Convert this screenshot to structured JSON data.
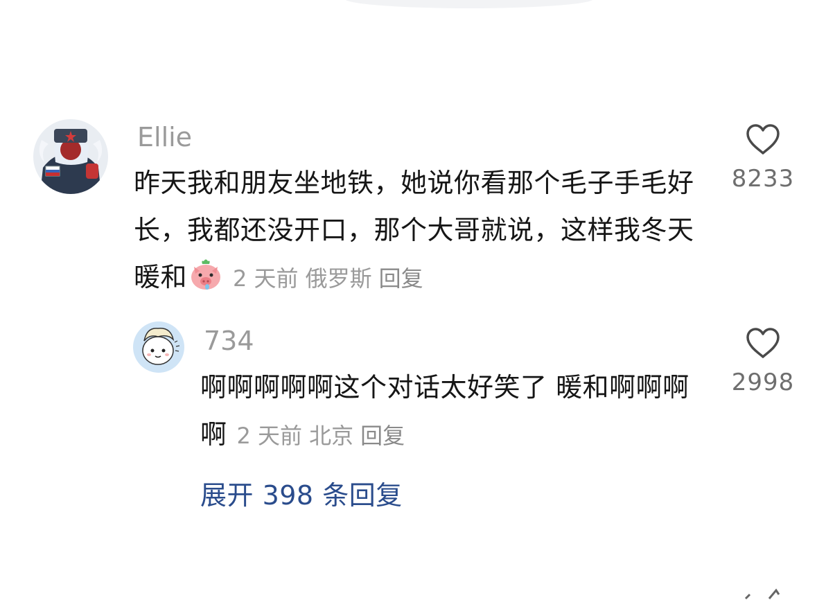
{
  "comments": [
    {
      "username": "Ellie",
      "text": "昨天我和朋友坐地铁，她说你看那个毛子手毛好长，我都还没开口，那个大哥就说，这样我冬天暖和",
      "emoji": "pig-face-emoji",
      "time": "2 天前",
      "location": "俄罗斯",
      "reply_label": "回复",
      "likes": "8233",
      "replies": [
        {
          "username": "734",
          "text": "啊啊啊啊啊这个对话太好笑了 暖和啊啊啊啊",
          "time": "2 天前",
          "location": "北京",
          "reply_label": "回复",
          "likes": "2998"
        }
      ],
      "expand_label": "展开 398 条回复"
    }
  ],
  "colors": {
    "username": "#9a9a9a",
    "text": "#161616",
    "meta": "#9a9a9a",
    "link": "#2a4c8c",
    "like_icon": "#4a4a4a"
  }
}
